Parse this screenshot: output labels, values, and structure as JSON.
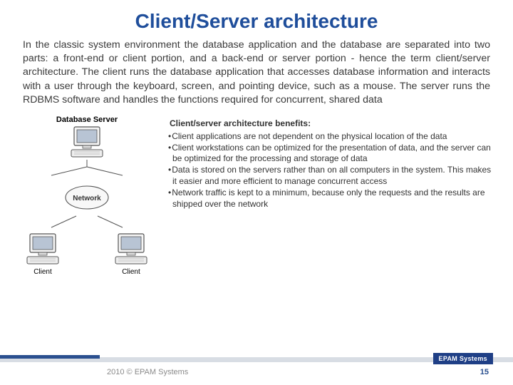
{
  "title": "Client/Server architecture",
  "paragraph": "In the classic system environment the database application and the database are separated into two parts: a front-end or client portion, and a back-end or server portion - hence the term client/server architecture. The client runs the database application that accesses database information and interacts with a user through the keyboard, screen, and pointing device, such as a mouse. The server runs the RDBMS software and handles the functions required for concurrent, shared data",
  "diagram": {
    "server_label": "Database Server",
    "network_label": "Network",
    "client_label_left": "Client",
    "client_label_right": "Client"
  },
  "benefits": {
    "heading": "Client/server architecture benefits:",
    "items": [
      "Client applications are not dependent on the physical location of the data",
      "Client workstations can be optimized for the presentation of data, and the server can be optimized for the processing and storage of data",
      "Data is stored on the servers rather than on all computers in the system. This makes it easier and more efficient to manage concurrent access",
      "Network traffic is kept to a minimum, because only the requests and the results are shipped over the network"
    ]
  },
  "footer": {
    "badge": "EPAM Systems",
    "copyright": "2010 © EPAM Systems",
    "page": "15"
  }
}
